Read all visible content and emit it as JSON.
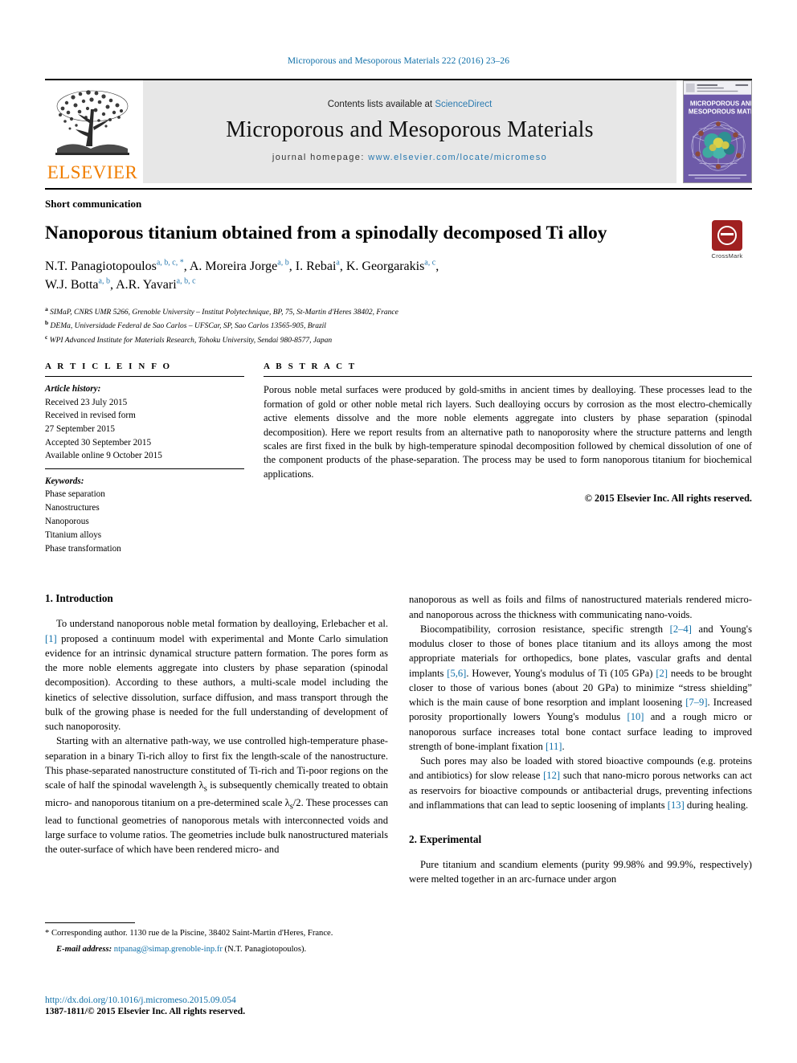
{
  "running_head": "Microporous and Mesoporous Materials 222 (2016) 23–26",
  "masthead": {
    "publisher_logo_text": "ELSEVIER",
    "contents_prefix": "Contents lists available at ",
    "contents_link": "ScienceDirect",
    "journal_title": "Microporous and Mesoporous Materials",
    "homepage_label": "journal homepage: ",
    "homepage_url": "www.elsevier.com/locate/micromeso",
    "cover_line1": "MICROPOROUS AND",
    "cover_line2": "MESOPOROUS MATERIALS",
    "cover_bg": "#6d5aa8"
  },
  "article": {
    "type_label": "Short communication",
    "title": "Nanoporous titanium obtained from a spinodally decomposed Ti alloy",
    "crossmark_label": "CrossMark",
    "authors_line1_a": "N.T. Panagiotopoulos",
    "authors_line1_a_sup": "a, b, c, *",
    "authors_line1_b": ", A. Moreira Jorge",
    "authors_line1_b_sup": "a, b",
    "authors_line1_c": ", I. Rebai",
    "authors_line1_c_sup": "a",
    "authors_line1_d": ", K. Georgarakis",
    "authors_line1_d_sup": "a, c",
    "authors_line1_end": ",",
    "authors_line2_a": "W.J. Botta",
    "authors_line2_a_sup": "a, b",
    "authors_line2_b": ", A.R. Yavari",
    "authors_line2_b_sup": "a, b, c",
    "affiliations": [
      {
        "mark": "a",
        "text": "SIMaP, CNRS UMR 5266, Grenoble University – Institut Polytechnique, BP, 75, St-Martin d'Heres 38402, France"
      },
      {
        "mark": "b",
        "text": "DEMa, Universidade Federal de Sao Carlos – UFSCar, SP, Sao Carlos 13565-905, Brazil"
      },
      {
        "mark": "c",
        "text": "WPI Advanced Institute for Materials Research, Tohoku University, Sendai 980-8577, Japan"
      }
    ]
  },
  "article_info": {
    "heading": "A R T I C L E  I N F O",
    "history_label": "Article history:",
    "history": [
      "Received 23 July 2015",
      "Received in revised form",
      "27 September 2015",
      "Accepted 30 September 2015",
      "Available online 9 October 2015"
    ],
    "keywords_label": "Keywords:",
    "keywords": [
      "Phase separation",
      "Nanostructures",
      "Nanoporous",
      "Titanium alloys",
      "Phase transformation"
    ]
  },
  "abstract": {
    "heading": "A B S T R A C T",
    "text": "Porous noble metal surfaces were produced by gold-smiths in ancient times by dealloying. These processes lead to the formation of gold or other noble metal rich layers. Such dealloying occurs by corrosion as the most electro-chemically active elements dissolve and the more noble elements aggregate into clusters by phase separation (spinodal decomposition). Here we report results from an alternative path to nanoporosity where the structure patterns and length scales are first fixed in the bulk by high-temperature spinodal decomposition followed by chemical dissolution of one of the component products of the phase-separation. The process may be used to form nanoporous titanium for biochemical applications.",
    "copyright": "© 2015 Elsevier Inc. All rights reserved."
  },
  "body": {
    "section1_heading": "1.  Introduction",
    "section2_heading": "2.  Experimental",
    "left_p1_a": "To understand nanoporous noble metal formation by dealloying, Erlebacher et al. ",
    "left_p1_ref1": "[1]",
    "left_p1_b": " proposed a continuum model with experimental and Monte Carlo simulation evidence for an intrinsic dynamical structure pattern formation. The pores form as the more noble elements aggregate into clusters by phase separation (spinodal decomposition). According to these authors, a multi-scale model including the kinetics of selective dissolution, surface diffusion, and mass transport through the bulk of the growing phase is needed for the full understanding of development of such nanoporosity.",
    "left_p2_a": "Starting with an alternative path-way, we use controlled high-temperature phase-separation in a binary Ti-rich alloy to first fix the length-scale of the nanostructure. This phase-separated nanostructure constituted of Ti-rich and Ti-poor regions on the scale of half the spinodal wavelength λ",
    "left_p2_sub1": "s",
    "left_p2_b": " is subsequently chemically treated to obtain micro- and nanoporous titanium on a pre-determined scale λ",
    "left_p2_sub2": "s",
    "left_p2_c": "/2. These processes can lead to functional geometries of nanoporous metals with interconnected voids and large surface to volume ratios. The geometries include bulk nanostructured materials the outer-surface of which have been rendered micro- and",
    "right_p1": "nanoporous as well as foils and films of nanostructured materials rendered micro- and nanoporous across the thickness with communicating nano-voids.",
    "right_p2_a": "Biocompatibility, corrosion resistance, specific strength ",
    "right_p2_ref1": "[2–4]",
    "right_p2_b": " and Young's modulus closer to those of bones place titanium and its alloys among the most appropriate materials for orthopedics, bone plates, vascular grafts and dental implants ",
    "right_p2_ref2": "[5,6]",
    "right_p2_c": ". However, Young's modulus of Ti (105 GPa) ",
    "right_p2_ref3": "[2]",
    "right_p2_d": " needs to be brought closer to those of various bones (about 20 GPa) to minimize “stress shielding” which is the main cause of bone resorption and implant loosening ",
    "right_p2_ref4": "[7–9]",
    "right_p2_e": ". Increased porosity proportionally lowers Young's modulus ",
    "right_p2_ref5": "[10]",
    "right_p2_f": " and a rough micro or nanoporous surface increases total bone contact surface leading to improved strength of bone-implant fixation ",
    "right_p2_ref6": "[11]",
    "right_p2_g": ".",
    "right_p3_a": "Such pores may also be loaded with stored bioactive compounds (e.g. proteins and antibiotics) for slow release ",
    "right_p3_ref1": "[12]",
    "right_p3_b": " such that nano-micro porous networks can act as reservoirs for bioactive compounds or antibacterial drugs, preventing infections and inflammations that can lead to septic loosening of implants ",
    "right_p3_ref2": "[13]",
    "right_p3_c": " during healing.",
    "right_p4": "Pure titanium and scandium elements (purity 99.98% and 99.9%, respectively) were melted together in an arc-furnace under argon"
  },
  "footer": {
    "corr_star": "*",
    "corr_text": " Corresponding author. 1130 rue de la Piscine, 38402 Saint-Martin d'Heres, France.",
    "email_label": "E-mail address:",
    "email_value": " ntpanag@simap.grenoble-inp.fr",
    "email_suffix": " (N.T. Panagiotopoulos).",
    "doi": "http://dx.doi.org/10.1016/j.micromeso.2015.09.054",
    "issn": "1387-1811/© 2015 Elsevier Inc. All rights reserved."
  },
  "colors": {
    "link": "#0f6fa8",
    "elsevier_orange": "#f07d00",
    "band_gray": "#e7e7e7",
    "crossmark_red": "#a02020"
  }
}
